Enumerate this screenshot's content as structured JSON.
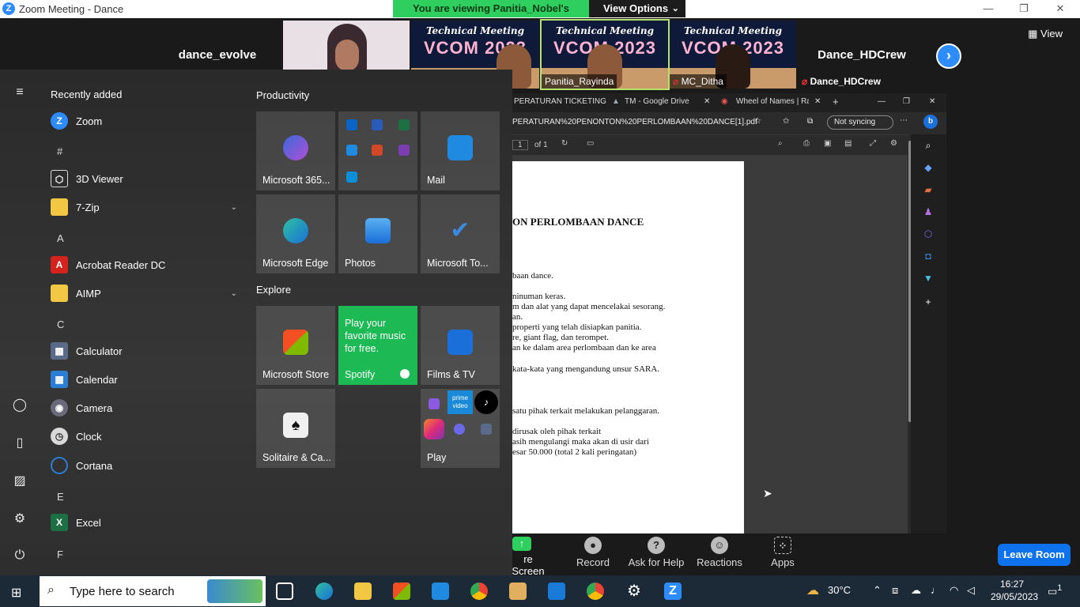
{
  "window": {
    "title": "Zoom Meeting - Dance"
  },
  "share_banner": {
    "message": "You are viewing Panitia_Nobel's screen",
    "options": "View Options"
  },
  "participants": {
    "first_name": "dance_evolve",
    "tiles": [
      "Panitia_Rayinda",
      "MC_Ditha",
      "Dance_HDCrew"
    ],
    "last_name": "Dance_HDCrew",
    "video_title": "Technical Meeting",
    "video_sub": "VCOM 2023",
    "view_label": "View"
  },
  "browser": {
    "tabs": [
      "PERATURAN TICKETING |",
      "TM - Google Drive",
      "Wheel of Names | Rand"
    ],
    "url": "PERATURAN%20PENONTON%20PERLOMBAAN%20DANCE[1].pdf",
    "sync": "Not syncing",
    "page_current": "1",
    "page_total": "of 1"
  },
  "pdf": {
    "heading": "ON PERLOMBAAN DANCE",
    "lines": [
      "baan dance.",
      "ninuman keras.",
      "m dan alat yang dapat mencelakai sesorang.",
      "an.",
      "properti yang telah disiapkan panitia.",
      "re, giant flag, dan terompet.",
      "an ke dalam area perlombaan dan ke area",
      "kata-kata yang mengandung unsur SARA.",
      "satu pihak terkait melakukan pelanggaran.",
      "dirusak oleh pihak terkait",
      "asih mengulangi maka akan di usir dari",
      "esar 50.000 (total 2 kali peringatan)"
    ]
  },
  "controls": {
    "share": "re Screen",
    "record": "Record",
    "help": "Ask for Help",
    "reactions": "Reactions",
    "apps": "Apps",
    "leave": "Leave Room"
  },
  "start_menu": {
    "recently_added": "Recently added",
    "apps": [
      {
        "name": "Zoom",
        "color": "#2d8cff"
      },
      {
        "letter": "#"
      },
      {
        "name": "3D Viewer",
        "color": "#555555"
      },
      {
        "name": "7-Zip",
        "color": "#f2c744",
        "expand": true
      },
      {
        "letter": "A"
      },
      {
        "name": "Acrobat Reader DC",
        "color": "#d4231c"
      },
      {
        "name": "AIMP",
        "color": "#f2c744",
        "expand": true
      },
      {
        "letter": "C"
      },
      {
        "name": "Calculator",
        "color": "#5a6b8a"
      },
      {
        "name": "Calendar",
        "color": "#2a7fd4"
      },
      {
        "name": "Camera",
        "color": "#6a6a7a"
      },
      {
        "name": "Clock",
        "color": "#d9d9d9"
      },
      {
        "name": "Cortana",
        "color": "#2a7fd4"
      },
      {
        "letter": "E"
      },
      {
        "name": "Excel",
        "color": "#1d7044"
      },
      {
        "letter": "F"
      }
    ],
    "groups": {
      "productivity": "Productivity",
      "explore": "Explore"
    },
    "tiles": {
      "m365": "Microsoft 365...",
      "mail": "Mail",
      "edge": "Microsoft Edge",
      "photos": "Photos",
      "todo": "Microsoft To...",
      "store": "Microsoft Store",
      "spotify_text": "Play your favorite music for free.",
      "spotify": "Spotify",
      "films": "Films & TV",
      "solitaire": "Solitaire & Ca...",
      "play": "Play",
      "prime": "prime video"
    }
  },
  "taskbar": {
    "search_placeholder": "Type here to search",
    "weather": "30°C",
    "time": "16:27",
    "date": "29/05/2023",
    "notifications": "1"
  }
}
